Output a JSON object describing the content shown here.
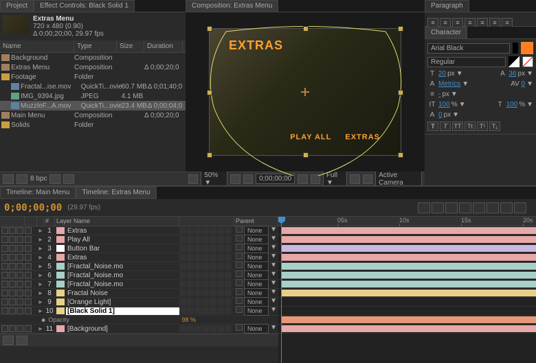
{
  "tabs": {
    "project": "Project",
    "effectControls": "Effect Controls: Black Solid 1",
    "composition": "Composition: Extras Menu",
    "paragraph": "Paragraph",
    "character": "Character"
  },
  "compHeader": {
    "title": "Extras Menu",
    "dims": "720 x 480 (0.90)",
    "dur": "Δ 0;00;20;00, 29.97 fps"
  },
  "projCols": {
    "name": "Name",
    "type": "Type",
    "size": "Size",
    "dur": "Duration"
  },
  "projItems": [
    {
      "name": "Background",
      "type": "Composition",
      "size": "",
      "dur": "",
      "icon": "comp",
      "indent": 0
    },
    {
      "name": "Extras Menu",
      "type": "Composition",
      "size": "",
      "dur": "Δ 0;00;20;0",
      "icon": "comp",
      "indent": 0
    },
    {
      "name": "Footage",
      "type": "Folder",
      "size": "",
      "dur": "",
      "icon": "fold",
      "indent": 0
    },
    {
      "name": "Fractal...ise.mov",
      "type": "QuickTi...ovie",
      "size": "60.7 MB",
      "dur": "Δ 0;01;40;0",
      "icon": "mov",
      "indent": 1
    },
    {
      "name": "IMG_9394.jpg",
      "type": "JPEG",
      "size": "4.1 MB",
      "dur": "",
      "icon": "img",
      "indent": 1
    },
    {
      "name": "MuzzleF...A.mov",
      "type": "QuickTi...ovie",
      "size": "23.4 MB",
      "dur": "Δ 0;00;04;0",
      "icon": "mov",
      "indent": 1,
      "sel": true
    },
    {
      "name": "Main Menu",
      "type": "Composition",
      "size": "",
      "dur": "Δ 0;00;20;0",
      "icon": "comp",
      "indent": 0
    },
    {
      "name": "Solids",
      "type": "Folder",
      "size": "",
      "dur": "",
      "icon": "fold",
      "indent": 0
    }
  ],
  "projFoot": {
    "bpc": "8 bpc"
  },
  "stage": {
    "title": "EXTRAS",
    "playAll": "PLAY ALL",
    "extras": "EXTRAS"
  },
  "compFoot": {
    "zoom": "50%",
    "time": "0;00;00;00",
    "res": "Full",
    "camera": "Active Camera"
  },
  "char": {
    "font": "Arial Black",
    "weight": "Regular",
    "sizeVal": "20",
    "sizeUnit": "px",
    "leadVal": "36",
    "leadUnit": "px",
    "kern": "Metrics",
    "track": "0",
    "baseline": "-",
    "baselineUnit": "px",
    "vscale": "100",
    "hscale": "100",
    "vscaleUnit": "%",
    "hscaleUnit": "%",
    "stroke": "0",
    "strokeUnit": "px",
    "fillOver": "Fill Over Stroke",
    "colorFill": "#ff8020"
  },
  "tlTabs": {
    "main": "Timeline: Main Menu",
    "extras": "Timeline: Extras Menu"
  },
  "tlHead": {
    "time": "0;00;00;00",
    "fps": "(29.97 fps)"
  },
  "tlCols": {
    "num": "#",
    "layerName": "Layer Name",
    "parent": "Parent"
  },
  "tlRuler": [
    "05s",
    "10s",
    "15s",
    "20s"
  ],
  "layers": [
    {
      "n": "1",
      "name": "Extras",
      "color": "#e8a8a8",
      "clip": "c-pink",
      "parent": "None"
    },
    {
      "n": "2",
      "name": "Play All",
      "color": "#e8a8a8",
      "clip": "c-pink",
      "parent": "None"
    },
    {
      "n": "3",
      "name": "Button Bar",
      "color": "#ffffff",
      "clip": "c-lav",
      "parent": "None",
      "nameBox": true
    },
    {
      "n": "4",
      "name": "Extras",
      "color": "#e8a8a8",
      "clip": "c-pink",
      "parent": "None"
    },
    {
      "n": "5",
      "name": "[Fractal_Noise.mo",
      "color": "#a8d0c8",
      "clip": "c-teal",
      "parent": "None"
    },
    {
      "n": "6",
      "name": "[Fractal_Noise.mo",
      "color": "#a8d0c8",
      "clip": "c-teal",
      "parent": "None"
    },
    {
      "n": "7",
      "name": "[Fractal_Noise.mo",
      "color": "#a8d0c8",
      "clip": "c-teal",
      "parent": "None"
    },
    {
      "n": "8",
      "name": "Fractal Noise",
      "color": "#e8d088",
      "clip": "c-yellow",
      "parent": "None"
    },
    {
      "n": "9",
      "name": "[Orange Light]",
      "color": "#e8d088",
      "clip": "",
      "parent": "None"
    },
    {
      "n": "10",
      "name": "[Black Solid 1]",
      "color": "#e8d088",
      "clip": "c-coral",
      "parent": "None",
      "sel": true
    },
    {
      "n": "11",
      "name": "[Background]",
      "color": "#e8a8a8",
      "clip": "c-pink",
      "parent": "None",
      "prop": "Opacity",
      "propVal": "98 %"
    }
  ]
}
